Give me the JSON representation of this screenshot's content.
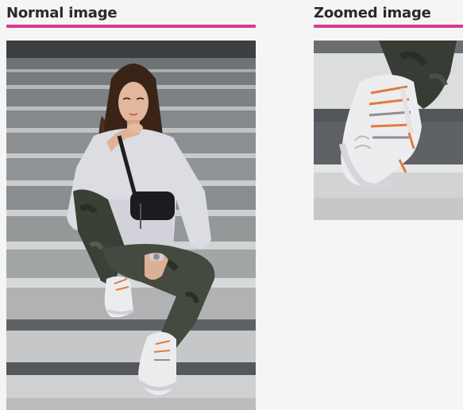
{
  "normal": {
    "title": "Normal image"
  },
  "zoomed": {
    "title": "Zoomed image"
  },
  "colors": {
    "accent": "#d63c8f",
    "title_text": "#2a2a2a",
    "background": "#f5f5f6"
  },
  "images": {
    "normal_alt": "woman sitting on stairs",
    "zoomed_alt": "close-up of sneaker"
  }
}
